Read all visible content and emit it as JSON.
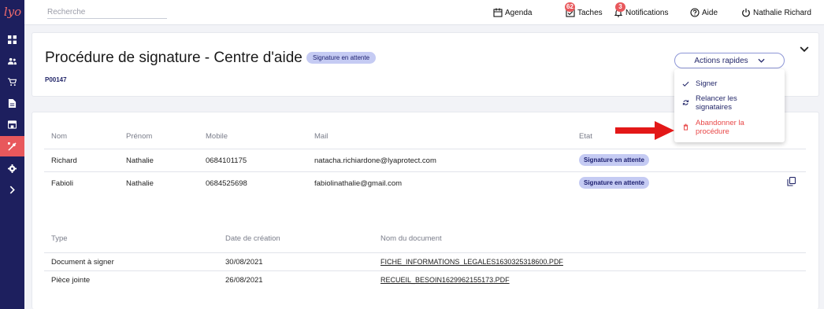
{
  "app": {
    "logo_text": "lyo"
  },
  "colors": {
    "sidebar": "#1d1f5e",
    "accent": "#e8585c",
    "badge_bg": "#c5cbf3",
    "primary_text": "#24286a",
    "danger": "#e84848"
  },
  "sidebar": {
    "items": [
      {
        "icon": "dashboard-icon"
      },
      {
        "icon": "users-icon"
      },
      {
        "icon": "cart-icon"
      },
      {
        "icon": "document-icon"
      },
      {
        "icon": "store-icon"
      },
      {
        "icon": "tools-icon",
        "active": true
      },
      {
        "icon": "settings-icon"
      },
      {
        "icon": "expand-icon"
      }
    ]
  },
  "topbar": {
    "search_placeholder": "Recherche",
    "agenda_label": "Agenda",
    "tasks_label": "Taches",
    "tasks_count": "62",
    "notifications_label": "Notifications",
    "notifications_count": "3",
    "help_label": "Aide",
    "user_label": "Nathalie Richard"
  },
  "header": {
    "title": "Procédure de signature - Centre d'aide",
    "status_badge": "Signature en attente",
    "reference": "P00147"
  },
  "quick_actions": {
    "button_label": "Actions rapides",
    "menu": [
      {
        "line1": "Signer",
        "line2": "",
        "icon": "check-icon"
      },
      {
        "line1": "Relancer les",
        "line2": "signataires",
        "icon": "refresh-icon"
      },
      {
        "line1": "Abandonner la",
        "line2": "procédure",
        "icon": "trash-icon"
      }
    ]
  },
  "signers": {
    "columns": [
      "Nom",
      "Prénom",
      "Mobile",
      "Mail",
      "Etat"
    ],
    "rows": [
      {
        "nom": "Richard",
        "prenom": "Nathalie",
        "mobile": "0684101175",
        "mail": "natacha.richiardone@lyaprotect.com",
        "etat": "Signature en attente"
      },
      {
        "nom": "Fabioli",
        "prenom": "Nathalie",
        "mobile": "0684525698",
        "mail": "fabiolinathalie@gmail.com",
        "etat": "Signature en attente"
      }
    ]
  },
  "documents": {
    "columns": [
      "Type",
      "Date de création",
      "Nom du document"
    ],
    "rows": [
      {
        "type": "Document à signer",
        "date": "30/08/2021",
        "name": "FICHE_INFORMATIONS_LEGALES1630325318600.PDF"
      },
      {
        "type": "Pièce jointe",
        "date": "26/08/2021",
        "name": "RECUEIL_BESOIN1629962155173.PDF"
      }
    ]
  }
}
